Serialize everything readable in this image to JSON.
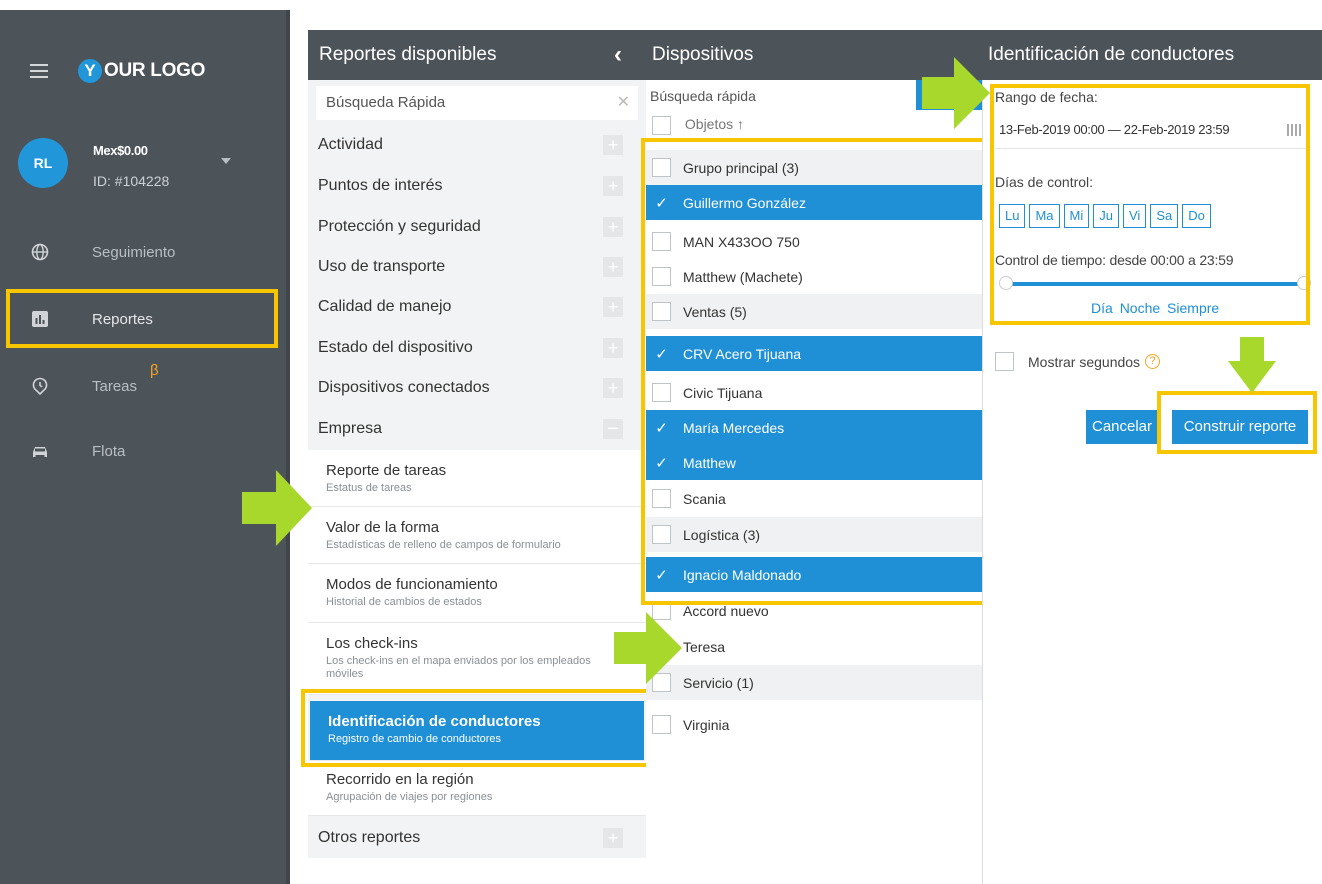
{
  "colors": {
    "sidebar": "#4c5359",
    "accent": "#1f8fd6",
    "highlight": "#f7c600",
    "arrow": "#a8d82b",
    "beta": "#f5a623"
  },
  "sidebar": {
    "logo_letter": "Y",
    "logo_text": "OUR LOGO",
    "avatar_initials": "RL",
    "balance": "Mex$0.00",
    "account_id": "ID: #104228",
    "items": [
      {
        "label": "Seguimiento",
        "icon": "globe-icon"
      },
      {
        "label": "Reportes",
        "icon": "chart-icon",
        "active": true
      },
      {
        "label": "Tareas",
        "icon": "clock-icon",
        "badge": "β"
      },
      {
        "label": "Flota",
        "icon": "car-icon"
      }
    ]
  },
  "reports": {
    "title": "Reportes disponibles",
    "collapse_glyph": "‹",
    "search_placeholder": "Búsqueda Rápida",
    "categories": [
      "Actividad",
      "Puntos de interés",
      "Protección y seguridad",
      "Uso de transporte",
      "Calidad de manejo",
      "Estado del dispositivo",
      "Dispositivos conectados",
      "Empresa"
    ],
    "subitems": [
      {
        "title": "Reporte de tareas",
        "desc": "Estatus de tareas"
      },
      {
        "title": "Valor de la forma",
        "desc": "Estadísticas de relleno de campos de formulario"
      },
      {
        "title": "Modos de funcionamiento",
        "desc": "Historial de cambios de estados"
      },
      {
        "title": "Los check-ins",
        "desc": "Los check-ins en el mapa enviados por los empleados móviles"
      },
      {
        "title": "Identificación de conductores",
        "desc": "Registro de cambio de conductores",
        "selected": true
      },
      {
        "title": "Recorrido en la región",
        "desc": "Agrupación de viajes por regiones"
      }
    ],
    "other": "Otros reportes"
  },
  "devices": {
    "title": "Dispositivos",
    "search_placeholder": "Búsqueda rápida",
    "objects_header": "Objetos",
    "sort_glyph": "↑",
    "rows": [
      {
        "label": "Grupo principal (3)",
        "type": "group"
      },
      {
        "label": "Guillermo González",
        "selected": true
      },
      {
        "label": "MAN X433OO 750"
      },
      {
        "label": "Matthew (Machete)"
      },
      {
        "label": "Ventas (5)",
        "type": "group"
      },
      {
        "label": "CRV Acero Tijuana",
        "selected": true
      },
      {
        "label": "Civic Tijuana"
      },
      {
        "label": "María Mercedes",
        "selected": true
      },
      {
        "label": "Matthew",
        "selected": true
      },
      {
        "label": "Scania"
      },
      {
        "label": "Logística (3)",
        "type": "group"
      },
      {
        "label": "Ignacio Maldonado",
        "selected": true
      },
      {
        "label": "Accord nuevo"
      },
      {
        "label": "Teresa"
      },
      {
        "label": "Servicio (1)",
        "type": "group"
      },
      {
        "label": "Virginia"
      }
    ]
  },
  "form": {
    "title": "Identificación de conductores",
    "date_label": "Rango de fecha:",
    "date_range": "13-Feb-2019 00:00 — 22-Feb-2019 23:59",
    "days_label": "Días de control:",
    "days": [
      "Lu",
      "Ma",
      "Mi",
      "Ju",
      "Vi",
      "Sa",
      "Do"
    ],
    "time_label": "Control de tiempo: desde 00:00 a 23:59",
    "time_presets": [
      "Día",
      "Noche",
      "Siempre"
    ],
    "show_seconds": "Mostrar segundos",
    "help_glyph": "?",
    "cancel": "Cancelar",
    "build": "Construir reporte"
  }
}
